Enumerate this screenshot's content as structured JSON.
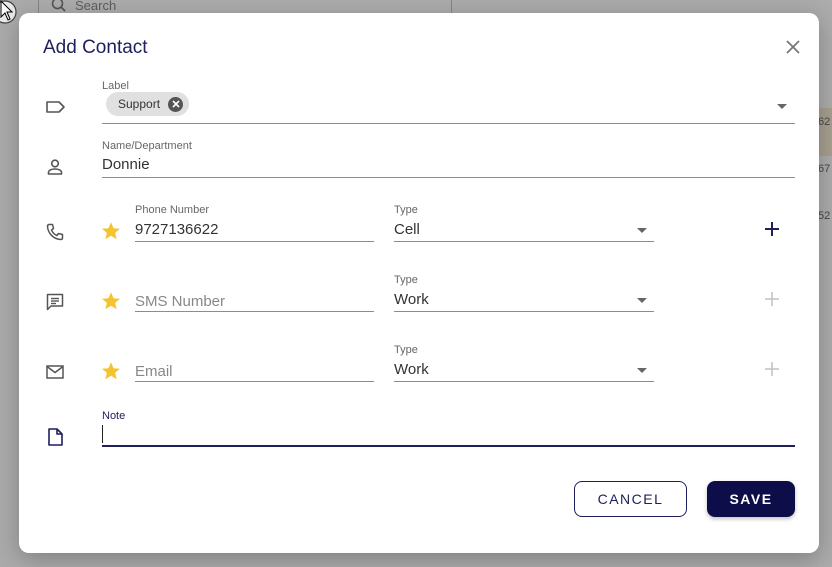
{
  "background": {
    "search_placeholder": "Search",
    "right_cells": [
      "62",
      "67",
      "52"
    ]
  },
  "dialog": {
    "title": "Add Contact",
    "label_field": {
      "label": "Label",
      "chips": [
        "Support"
      ]
    },
    "name_field": {
      "label": "Name/Department",
      "value": "Donnie"
    },
    "phone": {
      "label": "Phone Number",
      "value": "9727136622",
      "type_label": "Type",
      "type_value": "Cell"
    },
    "sms": {
      "placeholder": "SMS Number",
      "type_label": "Type",
      "type_value": "Work"
    },
    "email": {
      "placeholder": "Email",
      "type_label": "Type",
      "type_value": "Work"
    },
    "note": {
      "label": "Note",
      "value": ""
    },
    "buttons": {
      "cancel": "CANCEL",
      "save": "SAVE"
    }
  },
  "colors": {
    "primary": "#0d0d4a",
    "title": "#1f1f5c",
    "star": "#f4c430",
    "note_focus": "#1f1f5c"
  }
}
